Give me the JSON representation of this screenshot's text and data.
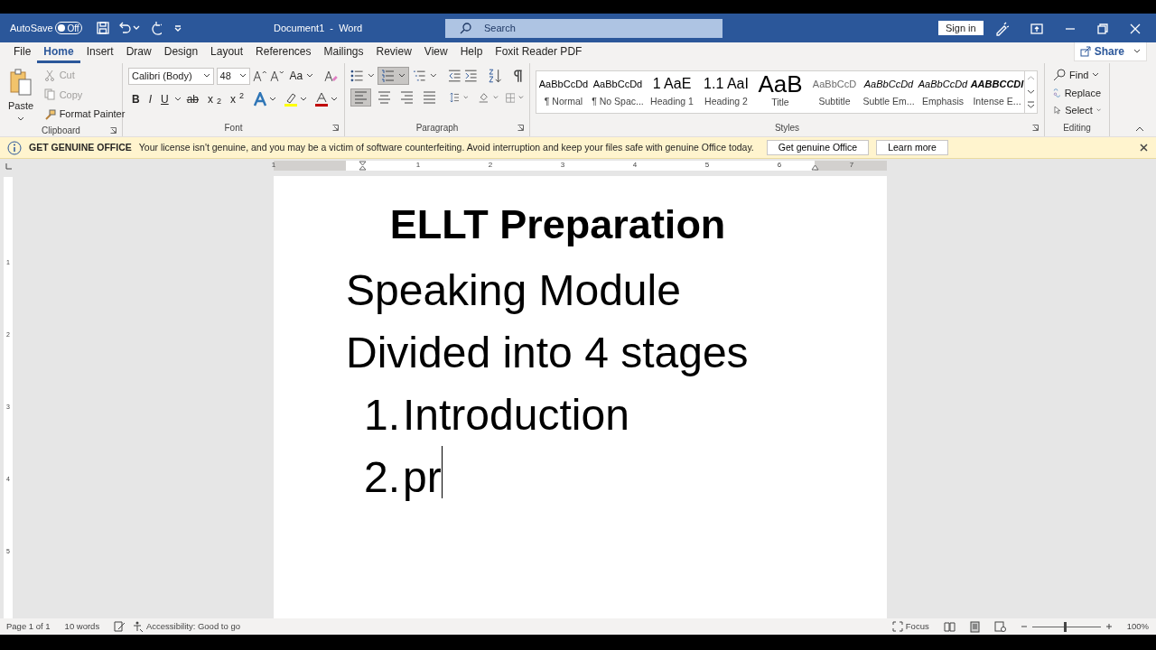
{
  "title_bar": {
    "autosave_label": "AutoSave",
    "autosave_state": "Off",
    "autosave_on": false,
    "document_title": "Document1  -  Word",
    "search_placeholder": "Search",
    "sign_in": "Sign in"
  },
  "tabs": [
    {
      "label": "File",
      "selected": false
    },
    {
      "label": "Home",
      "selected": true
    },
    {
      "label": "Insert",
      "selected": false
    },
    {
      "label": "Draw",
      "selected": false
    },
    {
      "label": "Design",
      "selected": false
    },
    {
      "label": "Layout",
      "selected": false
    },
    {
      "label": "References",
      "selected": false
    },
    {
      "label": "Mailings",
      "selected": false
    },
    {
      "label": "Review",
      "selected": false
    },
    {
      "label": "View",
      "selected": false
    },
    {
      "label": "Help",
      "selected": false
    },
    {
      "label": "Foxit Reader PDF",
      "selected": false
    }
  ],
  "share": "Share",
  "clipboard": {
    "paste": "Paste",
    "items": [
      {
        "label": "Cut",
        "disabled": true
      },
      {
        "label": "Copy",
        "disabled": true
      },
      {
        "label": "Format Painter",
        "disabled": false
      }
    ],
    "label": "Clipboard"
  },
  "font": {
    "font_name": "Calibri (Body)",
    "font_size": "48",
    "case_button": "Aa",
    "format_buttons": [
      "B",
      "I",
      "U",
      "ab",
      "x$_{2}$",
      "x$^{2}$"
    ],
    "label": "Font"
  },
  "paragraph": {
    "numbering_on": true,
    "alignments": [
      {
        "kind": "left",
        "selected": true
      },
      {
        "kind": "center",
        "selected": false
      },
      {
        "kind": "right",
        "selected": false
      },
      {
        "kind": "justify",
        "selected": false
      }
    ],
    "label": "Paragraph"
  },
  "styles": {
    "items": [
      {
        "preview": "AaBbCcDd",
        "name": "¶ Normal",
        "kind": "normal"
      },
      {
        "preview": "AaBbCcDd",
        "name": "¶ No Spac...",
        "kind": "normal"
      },
      {
        "preview": "1  AaE",
        "name": "Heading 1",
        "kind": "heading"
      },
      {
        "preview": "1.1  AaI",
        "name": "Heading 2",
        "kind": "heading"
      },
      {
        "preview": "AaB",
        "name": "Title",
        "kind": "title"
      },
      {
        "preview": "AaBbCcD",
        "name": "Subtitle",
        "kind": "subtitle"
      },
      {
        "preview": "AaBbCcDd",
        "name": "Subtle Em...",
        "kind": "italic"
      },
      {
        "preview": "AaBbCcDd",
        "name": "Emphasis",
        "kind": "italic"
      },
      {
        "preview": "AABBCCDI",
        "name": "Intense E...",
        "kind": "strong"
      }
    ],
    "label": "Styles"
  },
  "editing": {
    "items": [
      {
        "label": "Find",
        "kind": "find"
      },
      {
        "label": "Replace",
        "kind": "replace"
      },
      {
        "label": "Select",
        "kind": "select"
      }
    ],
    "label": "Editing"
  },
  "message_bar": {
    "title": "GET GENUINE OFFICE",
    "text": "Your license isn't genuine, and you may be a victim of software counterfeiting. Avoid interruption and keep your files safe with genuine Office today.",
    "buttons": [
      "Get genuine Office",
      "Learn more"
    ]
  },
  "ruler": {
    "labels": [
      "1",
      "1",
      "2",
      "3",
      "4",
      "5",
      "6",
      "7"
    ],
    "vertical_labels": [
      "1",
      "2",
      "3",
      "4",
      "5"
    ]
  },
  "document": {
    "lines": [
      {
        "kind": "title",
        "text": "ELLT Preparation"
      },
      {
        "kind": "paragraph",
        "text": "Speaking Module"
      },
      {
        "kind": "paragraph",
        "text": "Divided into 4 stages"
      },
      {
        "kind": "list_item",
        "number": "1.",
        "text": "Introduction",
        "cursor": false
      },
      {
        "kind": "list_item",
        "number": "2.",
        "text": "pr",
        "cursor": true
      }
    ]
  },
  "status_bar": {
    "page": "Page 1 of 1",
    "words": "10 words",
    "accessibility": "Accessibility: Good to go",
    "focus": "Focus",
    "zoom": {
      "level": 0.46,
      "reading": "100%"
    }
  }
}
